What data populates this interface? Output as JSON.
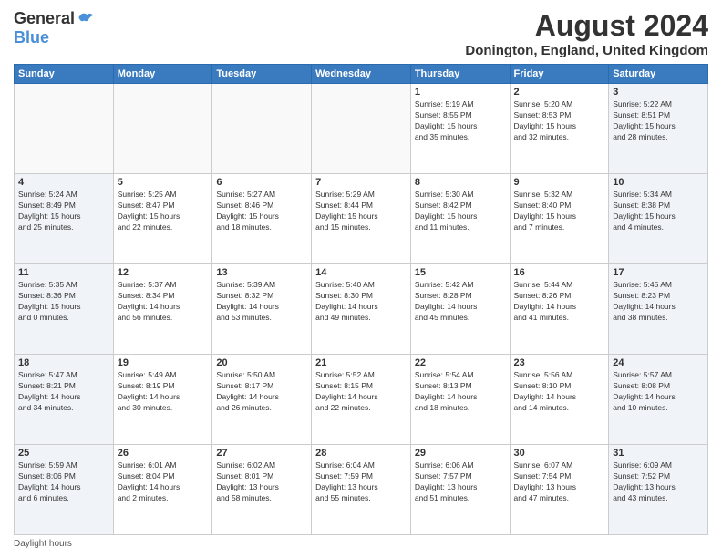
{
  "logo": {
    "general": "General",
    "blue": "Blue"
  },
  "title": {
    "month_year": "August 2024",
    "location": "Donington, England, United Kingdom"
  },
  "weekdays": [
    "Sunday",
    "Monday",
    "Tuesday",
    "Wednesday",
    "Thursday",
    "Friday",
    "Saturday"
  ],
  "footer": {
    "daylight_label": "Daylight hours"
  },
  "weeks": [
    [
      {
        "day": "",
        "info": ""
      },
      {
        "day": "",
        "info": ""
      },
      {
        "day": "",
        "info": ""
      },
      {
        "day": "",
        "info": ""
      },
      {
        "day": "1",
        "info": "Sunrise: 5:19 AM\nSunset: 8:55 PM\nDaylight: 15 hours\nand 35 minutes."
      },
      {
        "day": "2",
        "info": "Sunrise: 5:20 AM\nSunset: 8:53 PM\nDaylight: 15 hours\nand 32 minutes."
      },
      {
        "day": "3",
        "info": "Sunrise: 5:22 AM\nSunset: 8:51 PM\nDaylight: 15 hours\nand 28 minutes."
      }
    ],
    [
      {
        "day": "4",
        "info": "Sunrise: 5:24 AM\nSunset: 8:49 PM\nDaylight: 15 hours\nand 25 minutes."
      },
      {
        "day": "5",
        "info": "Sunrise: 5:25 AM\nSunset: 8:47 PM\nDaylight: 15 hours\nand 22 minutes."
      },
      {
        "day": "6",
        "info": "Sunrise: 5:27 AM\nSunset: 8:46 PM\nDaylight: 15 hours\nand 18 minutes."
      },
      {
        "day": "7",
        "info": "Sunrise: 5:29 AM\nSunset: 8:44 PM\nDaylight: 15 hours\nand 15 minutes."
      },
      {
        "day": "8",
        "info": "Sunrise: 5:30 AM\nSunset: 8:42 PM\nDaylight: 15 hours\nand 11 minutes."
      },
      {
        "day": "9",
        "info": "Sunrise: 5:32 AM\nSunset: 8:40 PM\nDaylight: 15 hours\nand 7 minutes."
      },
      {
        "day": "10",
        "info": "Sunrise: 5:34 AM\nSunset: 8:38 PM\nDaylight: 15 hours\nand 4 minutes."
      }
    ],
    [
      {
        "day": "11",
        "info": "Sunrise: 5:35 AM\nSunset: 8:36 PM\nDaylight: 15 hours\nand 0 minutes."
      },
      {
        "day": "12",
        "info": "Sunrise: 5:37 AM\nSunset: 8:34 PM\nDaylight: 14 hours\nand 56 minutes."
      },
      {
        "day": "13",
        "info": "Sunrise: 5:39 AM\nSunset: 8:32 PM\nDaylight: 14 hours\nand 53 minutes."
      },
      {
        "day": "14",
        "info": "Sunrise: 5:40 AM\nSunset: 8:30 PM\nDaylight: 14 hours\nand 49 minutes."
      },
      {
        "day": "15",
        "info": "Sunrise: 5:42 AM\nSunset: 8:28 PM\nDaylight: 14 hours\nand 45 minutes."
      },
      {
        "day": "16",
        "info": "Sunrise: 5:44 AM\nSunset: 8:26 PM\nDaylight: 14 hours\nand 41 minutes."
      },
      {
        "day": "17",
        "info": "Sunrise: 5:45 AM\nSunset: 8:23 PM\nDaylight: 14 hours\nand 38 minutes."
      }
    ],
    [
      {
        "day": "18",
        "info": "Sunrise: 5:47 AM\nSunset: 8:21 PM\nDaylight: 14 hours\nand 34 minutes."
      },
      {
        "day": "19",
        "info": "Sunrise: 5:49 AM\nSunset: 8:19 PM\nDaylight: 14 hours\nand 30 minutes."
      },
      {
        "day": "20",
        "info": "Sunrise: 5:50 AM\nSunset: 8:17 PM\nDaylight: 14 hours\nand 26 minutes."
      },
      {
        "day": "21",
        "info": "Sunrise: 5:52 AM\nSunset: 8:15 PM\nDaylight: 14 hours\nand 22 minutes."
      },
      {
        "day": "22",
        "info": "Sunrise: 5:54 AM\nSunset: 8:13 PM\nDaylight: 14 hours\nand 18 minutes."
      },
      {
        "day": "23",
        "info": "Sunrise: 5:56 AM\nSunset: 8:10 PM\nDaylight: 14 hours\nand 14 minutes."
      },
      {
        "day": "24",
        "info": "Sunrise: 5:57 AM\nSunset: 8:08 PM\nDaylight: 14 hours\nand 10 minutes."
      }
    ],
    [
      {
        "day": "25",
        "info": "Sunrise: 5:59 AM\nSunset: 8:06 PM\nDaylight: 14 hours\nand 6 minutes."
      },
      {
        "day": "26",
        "info": "Sunrise: 6:01 AM\nSunset: 8:04 PM\nDaylight: 14 hours\nand 2 minutes."
      },
      {
        "day": "27",
        "info": "Sunrise: 6:02 AM\nSunset: 8:01 PM\nDaylight: 13 hours\nand 58 minutes."
      },
      {
        "day": "28",
        "info": "Sunrise: 6:04 AM\nSunset: 7:59 PM\nDaylight: 13 hours\nand 55 minutes."
      },
      {
        "day": "29",
        "info": "Sunrise: 6:06 AM\nSunset: 7:57 PM\nDaylight: 13 hours\nand 51 minutes."
      },
      {
        "day": "30",
        "info": "Sunrise: 6:07 AM\nSunset: 7:54 PM\nDaylight: 13 hours\nand 47 minutes."
      },
      {
        "day": "31",
        "info": "Sunrise: 6:09 AM\nSunset: 7:52 PM\nDaylight: 13 hours\nand 43 minutes."
      }
    ]
  ]
}
